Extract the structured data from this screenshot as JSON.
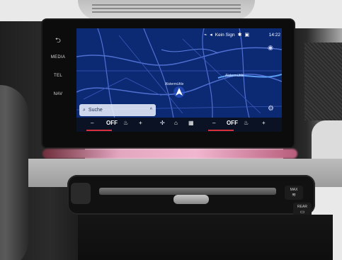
{
  "side_buttons": {
    "back_icon": "back-arrow-icon",
    "media": "MEDIA",
    "tel": "TEL",
    "nav": "NAV"
  },
  "status_bar": {
    "nav_icon": "navigation-arrow-icon",
    "signal_text": "Kein Sign",
    "time": "14:22"
  },
  "map": {
    "labels": [
      "Alstermühle",
      "Alstermühle"
    ],
    "colors": {
      "background": "#0c2a74",
      "roads": "#4f6fd1",
      "water": "#173a9a"
    }
  },
  "search": {
    "placeholder": "Suche",
    "chevron": "^"
  },
  "climate": {
    "left_temp": "OFF",
    "right_temp": "OFF",
    "minus": "–",
    "plus": "+",
    "left_fill": 0.4,
    "right_fill": 0.4,
    "fill_color": "#d8313c"
  },
  "vent_buttons": {
    "max": "MAX",
    "rear": "REAR"
  }
}
